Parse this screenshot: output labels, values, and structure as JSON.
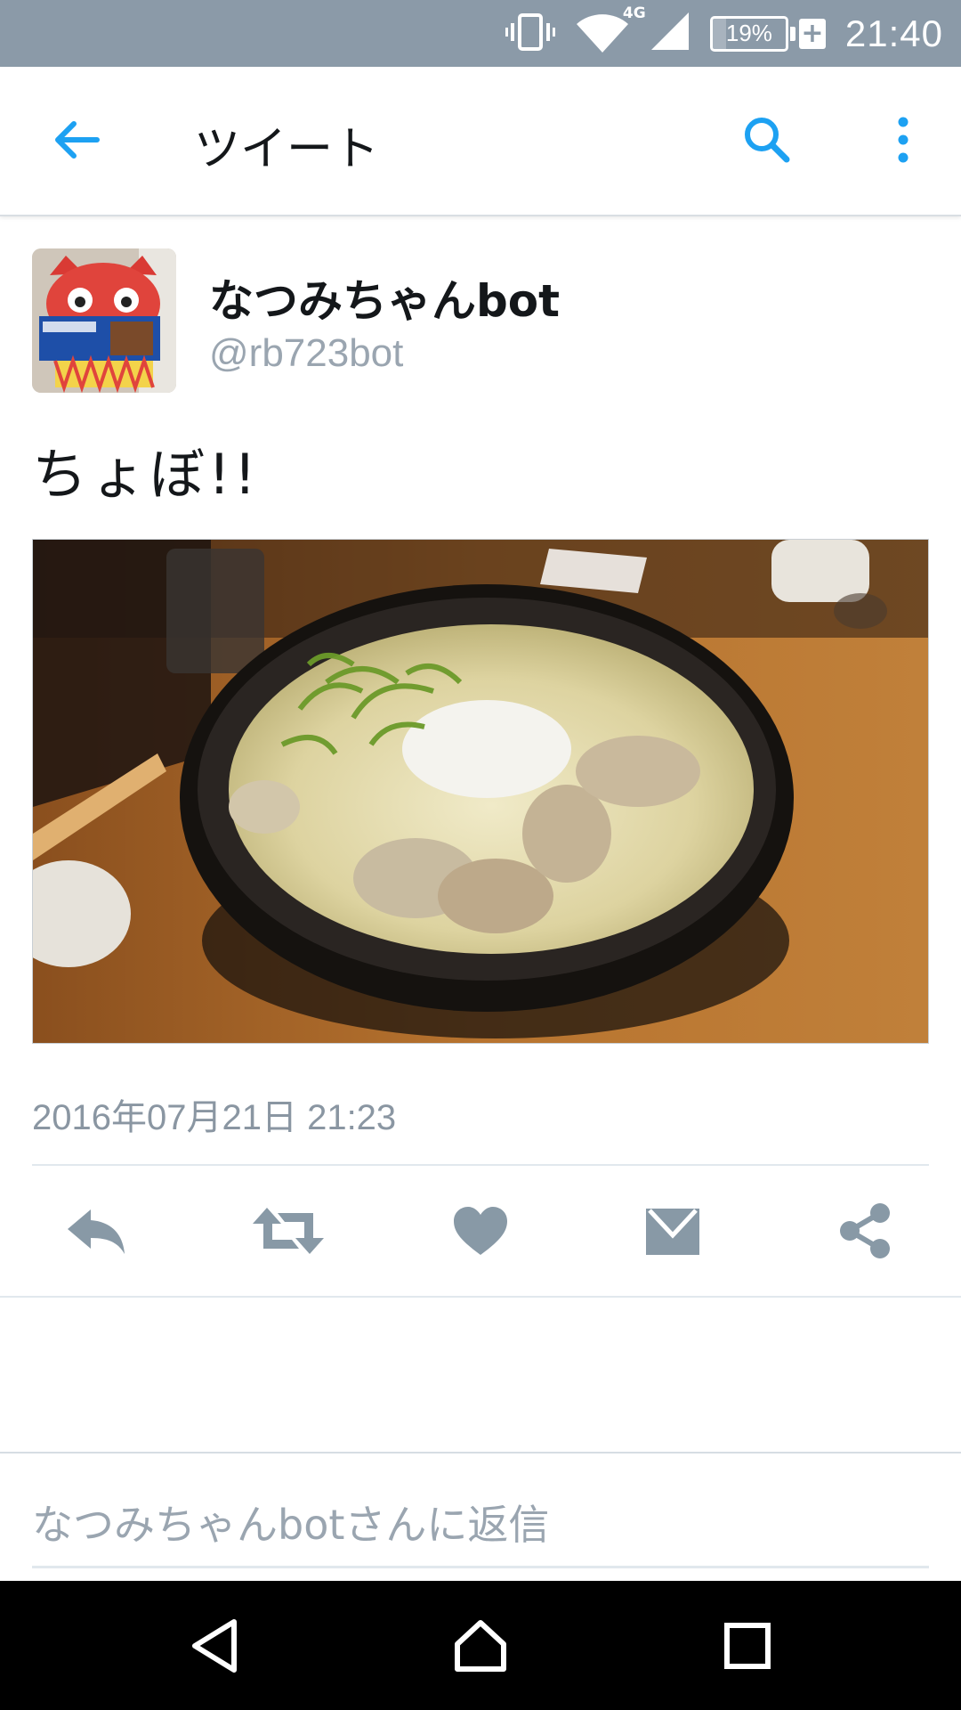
{
  "status_bar": {
    "network": "4G",
    "battery_percent": "19%",
    "battery_level": 0.19,
    "time": "21:40",
    "icons": [
      "vibrate-icon",
      "wifi-icon",
      "cell-signal-icon",
      "battery-icon",
      "charging-plus-icon"
    ]
  },
  "app_bar": {
    "title": "ツイート",
    "icons": [
      "back-arrow-icon",
      "search-icon",
      "more-vert-icon"
    ]
  },
  "tweet": {
    "display_name": "なつみちゃんbot",
    "handle": "@rb723bot",
    "text": "ちょぼ!!",
    "media_description_icon": "ramen-photo",
    "timestamp": "2016年07月21日 21:23",
    "actions": [
      "reply-icon",
      "retweet-icon",
      "like-icon",
      "direct-message-icon",
      "share-icon"
    ]
  },
  "reply": {
    "placeholder": "なつみちゃんbotさんに返信"
  },
  "colors": {
    "status_bar": "#8b9aa8",
    "accent": "#1da1f2",
    "action_icon": "#8899a6",
    "text_primary": "#14171a",
    "text_secondary": "#9aa5b0"
  },
  "nav_bar": {
    "icons": [
      "nav-back-icon",
      "nav-home-icon",
      "nav-recents-icon"
    ]
  }
}
